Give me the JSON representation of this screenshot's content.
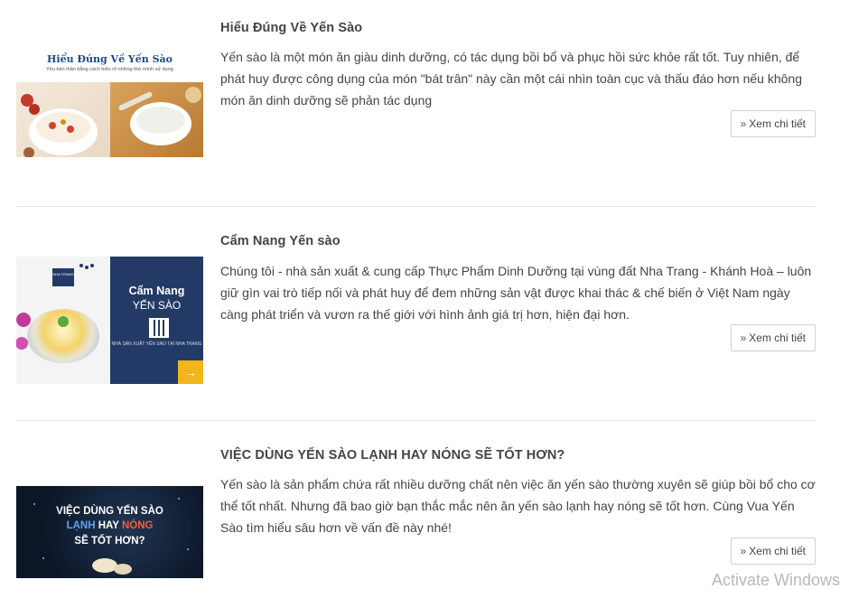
{
  "articles": [
    {
      "title": "Hiểu Đúng Về Yến Sào",
      "excerpt": "Yến sào là một món ăn giàu dinh dưỡng, có tác dụng bồi bổ và phục hồi sức khỏe rất tốt. Tuy nhiên, để phát huy được công dụng của món \"bát trân\" này cần một cái nhìn toàn cục và thấu đáo hơn nếu không món ăn dinh dưỡng sẽ phản tác dụng",
      "button": "Xem chi tiết",
      "thumb": {
        "title": "Hiểu Đúng Về Yến Sào",
        "subtitle": "Yêu bản thân bằng cách hiểu rõ những thứ mình sử dụng"
      }
    },
    {
      "title": "Cẩm Nang Yến sào",
      "excerpt": "Chúng tôi - nhà sản xuất & cung cấp Thực Phẩm Dinh Dưỡng tại vùng đất Nha Trang - Khánh Hoà – luôn giữ gìn vai trò tiếp nối và phát huy để đem những sản vật được khai thác & chế biến ở Việt Nam ngày càng phát triển và vươn ra thế giới với hình ảnh giá trị hơn, hiện đại hơn.",
      "button": "Xem chi tiết",
      "thumb": {
        "line1": "Cẩm Nang",
        "line2": "YẾN SÀO",
        "line3": "NHÀ SẢN XUẤT YẾN SÀO TẠI NHA TRANG",
        "logo": "NHA TRANG"
      }
    },
    {
      "title": "VIỆC DÙNG YẾN SÀO LẠNH HAY NÓNG SẼ TỐT HƠN?",
      "excerpt": "Yến sào là sản phẩm chứa rất nhiều dưỡng chất nên việc ăn yến sào thường xuyên sẽ giúp bồi bổ cho cơ thể tốt nhất. Nhưng đã bao giờ bạn thắc mắc nên ăn yến sào lạnh hay nóng sẽ tốt hơn. Cùng Vua Yến Sào tìm hiểu sâu hơn về vấn đề này nhé!",
      "button": "Xem chi tiết",
      "thumb": {
        "line1": "VIỆC DÙNG YẾN SÀO",
        "line2a": "LẠNH",
        "line2b": " HAY ",
        "line2c": "NÓNG",
        "line3": "SẼ TỐT HƠN?"
      }
    }
  ],
  "icons": {
    "chevron": "double-chevron-right-icon",
    "arrow": "arrow-right-icon"
  },
  "watermark": "Activate Windows"
}
